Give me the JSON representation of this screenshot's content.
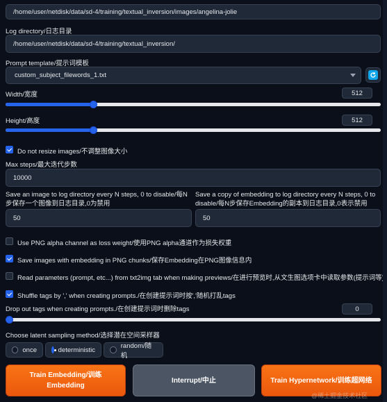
{
  "dataset_path": {
    "value": "/home/user/netdisk/data/sd-4/training/textual_inversion/images/angelina-jolie"
  },
  "log_directory": {
    "label": "Log directory/日志目录",
    "value": "/home/user/netdisk/data/sd-4/training/textual_inversion/"
  },
  "prompt_template": {
    "label": "Prompt template/提示词模板",
    "value": "custom_subject_filewords_1.txt"
  },
  "width": {
    "label": "Width/宽度",
    "value": "512",
    "fraction": 0.25
  },
  "height": {
    "label": "Height/高度",
    "value": "512",
    "fraction": 0.25
  },
  "do_not_resize": {
    "label": "Do not resize images/不调整图像大小",
    "checked": true
  },
  "max_steps": {
    "label": "Max steps/最大迭代步数",
    "value": "10000"
  },
  "save_image_every": {
    "label": "Save an image to log directory every N steps, 0 to disable/每N步保存一个图像到日志目录,0为禁用",
    "value": "50"
  },
  "save_embedding_every": {
    "label": "Save a copy of embedding to log directory every N steps, 0 to disable/每N步保存Embedding的副本到日志目录,0表示禁用",
    "value": "50"
  },
  "options": {
    "png_alpha": {
      "label": "Use PNG alpha channel as loss weight/使用PNG alpha通道作为损失权重",
      "checked": false
    },
    "save_png_chunks": {
      "label": "Save images with embedding in PNG chunks/保存Embedding在PNG图像信息内",
      "checked": true
    },
    "read_params": {
      "label": "Read parameters (prompt, etc...) from txt2img tab when making previews/在进行预览时,从文生图选项卡中读取参数(提示词等)",
      "checked": false
    },
    "shuffle_tags": {
      "label": "Shuffle tags by ',' when creating prompts./在创建提示词时按','随机打乱tags",
      "checked": true
    }
  },
  "drop_out": {
    "label": "Drop out tags when creating prompts./在创建提示词时删除tags",
    "value": "0",
    "fraction": 0.0
  },
  "latent_sampling": {
    "label": "Choose latent sampling method/选择潜在空间采样器",
    "options": [
      "once",
      "deterministic",
      "random/随机"
    ],
    "selected": "deterministic"
  },
  "buttons": {
    "train_embedding": "Train Embedding/训练 Embedding",
    "interrupt": "Interrupt/中止",
    "train_hypernetwork": "Train Hypernetwork/训练超网络"
  },
  "watermark": "@稀土掘金技术社区",
  "colors": {
    "accent": "#2563eb",
    "orange": "#f97316",
    "background": "#0b0f19"
  },
  "icons": {
    "refresh": "refresh-icon",
    "dropdown": "chevron-down-icon"
  }
}
